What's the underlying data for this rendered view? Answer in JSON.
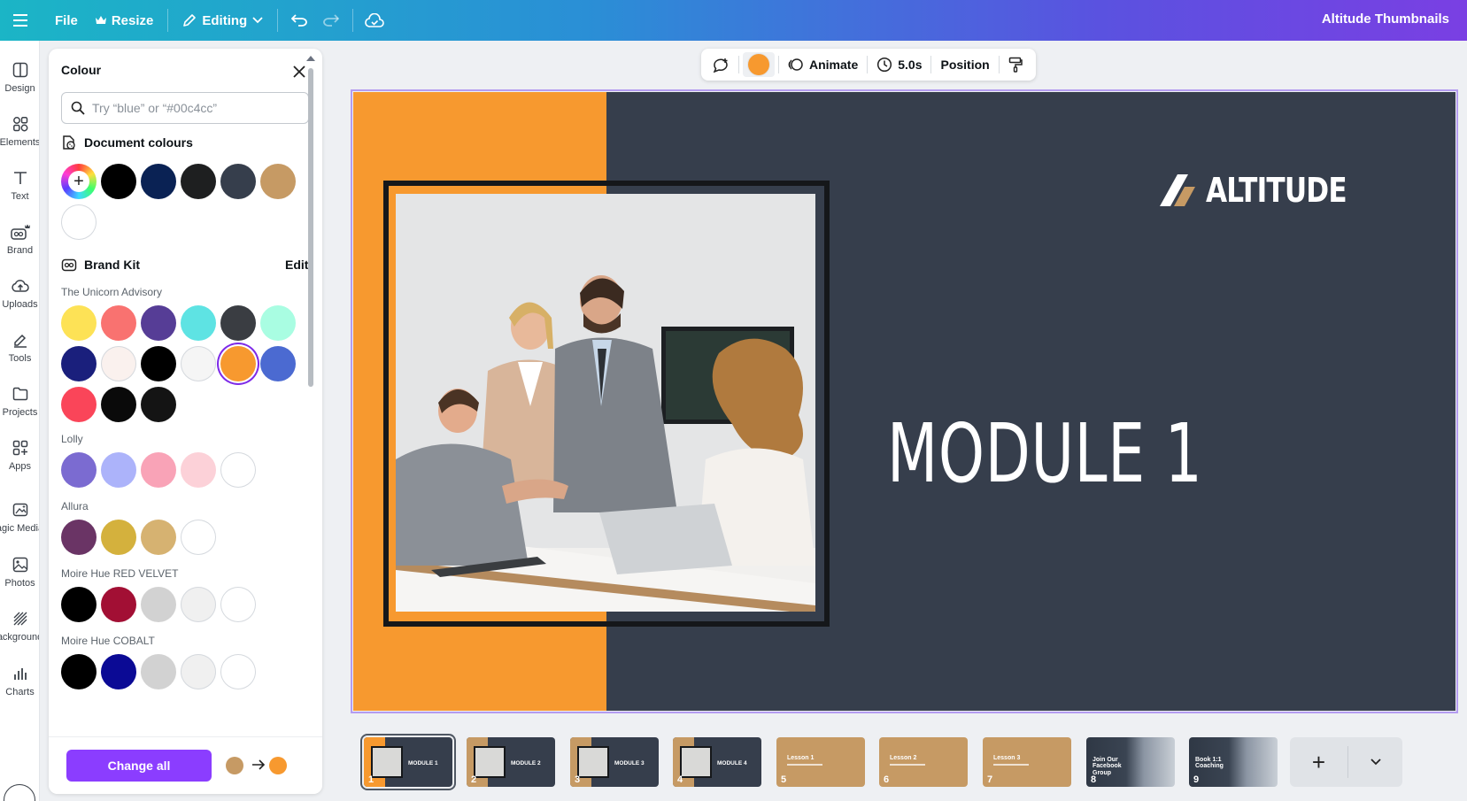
{
  "topbar": {
    "file": "File",
    "resize": "Resize",
    "editing": "Editing",
    "title": "Altitude Thumbnails"
  },
  "rail": {
    "items": [
      {
        "label": "Design",
        "icon": "design-icon"
      },
      {
        "label": "Elements",
        "icon": "elements-icon"
      },
      {
        "label": "Text",
        "icon": "text-icon"
      },
      {
        "label": "Brand",
        "icon": "brand-icon"
      },
      {
        "label": "Uploads",
        "icon": "uploads-icon"
      },
      {
        "label": "Tools",
        "icon": "tools-icon"
      },
      {
        "label": "Projects",
        "icon": "folder-icon"
      },
      {
        "label": "Apps",
        "icon": "apps-icon"
      },
      {
        "label": "agic Media",
        "icon": "magic-media-icon"
      },
      {
        "label": "Photos",
        "icon": "photos-icon"
      },
      {
        "label": "ackground",
        "icon": "background-icon"
      },
      {
        "label": "Charts",
        "icon": "charts-icon"
      }
    ]
  },
  "panel": {
    "title": "Colour",
    "search_placeholder": "Try “blue” or “#00c4cc”",
    "document_colours": {
      "heading": "Document colours",
      "colors": [
        "#000000",
        "#0a2254",
        "#1e1f20",
        "#363e4c",
        "#c69a64",
        "#ffffff"
      ]
    },
    "brand_kit": {
      "heading": "Brand Kit",
      "edit": "Edit",
      "palettes": [
        {
          "name": "The Unicorn Advisory",
          "colors": [
            "#fde256",
            "#f97270",
            "#563d96",
            "#5ee3e3",
            "#3a3d42",
            "#a9fde2",
            "#1a1f7c",
            "#faf1ee",
            "#000000",
            "#f5f5f5",
            "#f7992f",
            "#4b6ad1",
            "#fa4559",
            "#0a0a0a",
            "#141414"
          ],
          "selected_index": 10
        },
        {
          "name": "Lolly",
          "colors": [
            "#7b6bd1",
            "#acb3fa",
            "#f9a3b7",
            "#fcd1d8",
            "#ffffff"
          ]
        },
        {
          "name": "Allura",
          "colors": [
            "#6a3465",
            "#d4b13d",
            "#d6b271",
            "#ffffff"
          ]
        },
        {
          "name": "Moire Hue RED VELVET",
          "colors": [
            "#000000",
            "#a20f34",
            "#d2d2d2",
            "#f0f0f0",
            "#ffffff"
          ]
        },
        {
          "name": "Moire Hue COBALT",
          "colors": [
            "#000000",
            "#0b0a95",
            "#d2d2d2",
            "#f0f0f0",
            "#ffffff"
          ]
        }
      ]
    },
    "footer": {
      "change_all": "Change all",
      "from_color": "#c69a64",
      "to_color": "#f7992f"
    }
  },
  "float_toolbar": {
    "animate": "Animate",
    "duration": "5.0s",
    "position": "Position",
    "fill_color": "#f7992f"
  },
  "canvas": {
    "logo": "ALTITUDE",
    "heading": "MODULE 1",
    "bg_color": "#363e4c",
    "accent_color": "#f7992f"
  },
  "pages": [
    {
      "num": "1",
      "title": "MODULE 1",
      "style": "module"
    },
    {
      "num": "2",
      "title": "MODULE 2",
      "style": "module"
    },
    {
      "num": "3",
      "title": "MODULE 3",
      "style": "module"
    },
    {
      "num": "4",
      "title": "MODULE 4",
      "style": "module"
    },
    {
      "num": "5",
      "title": "Lesson 1",
      "style": "lesson"
    },
    {
      "num": "6",
      "title": "Lesson 2",
      "style": "lesson"
    },
    {
      "num": "7",
      "title": "Lesson 3",
      "style": "lesson"
    },
    {
      "num": "8",
      "title": "Join Our Facebook Group",
      "style": "photo"
    },
    {
      "num": "9",
      "title": "Book 1:1 Coaching",
      "style": "photo"
    }
  ]
}
